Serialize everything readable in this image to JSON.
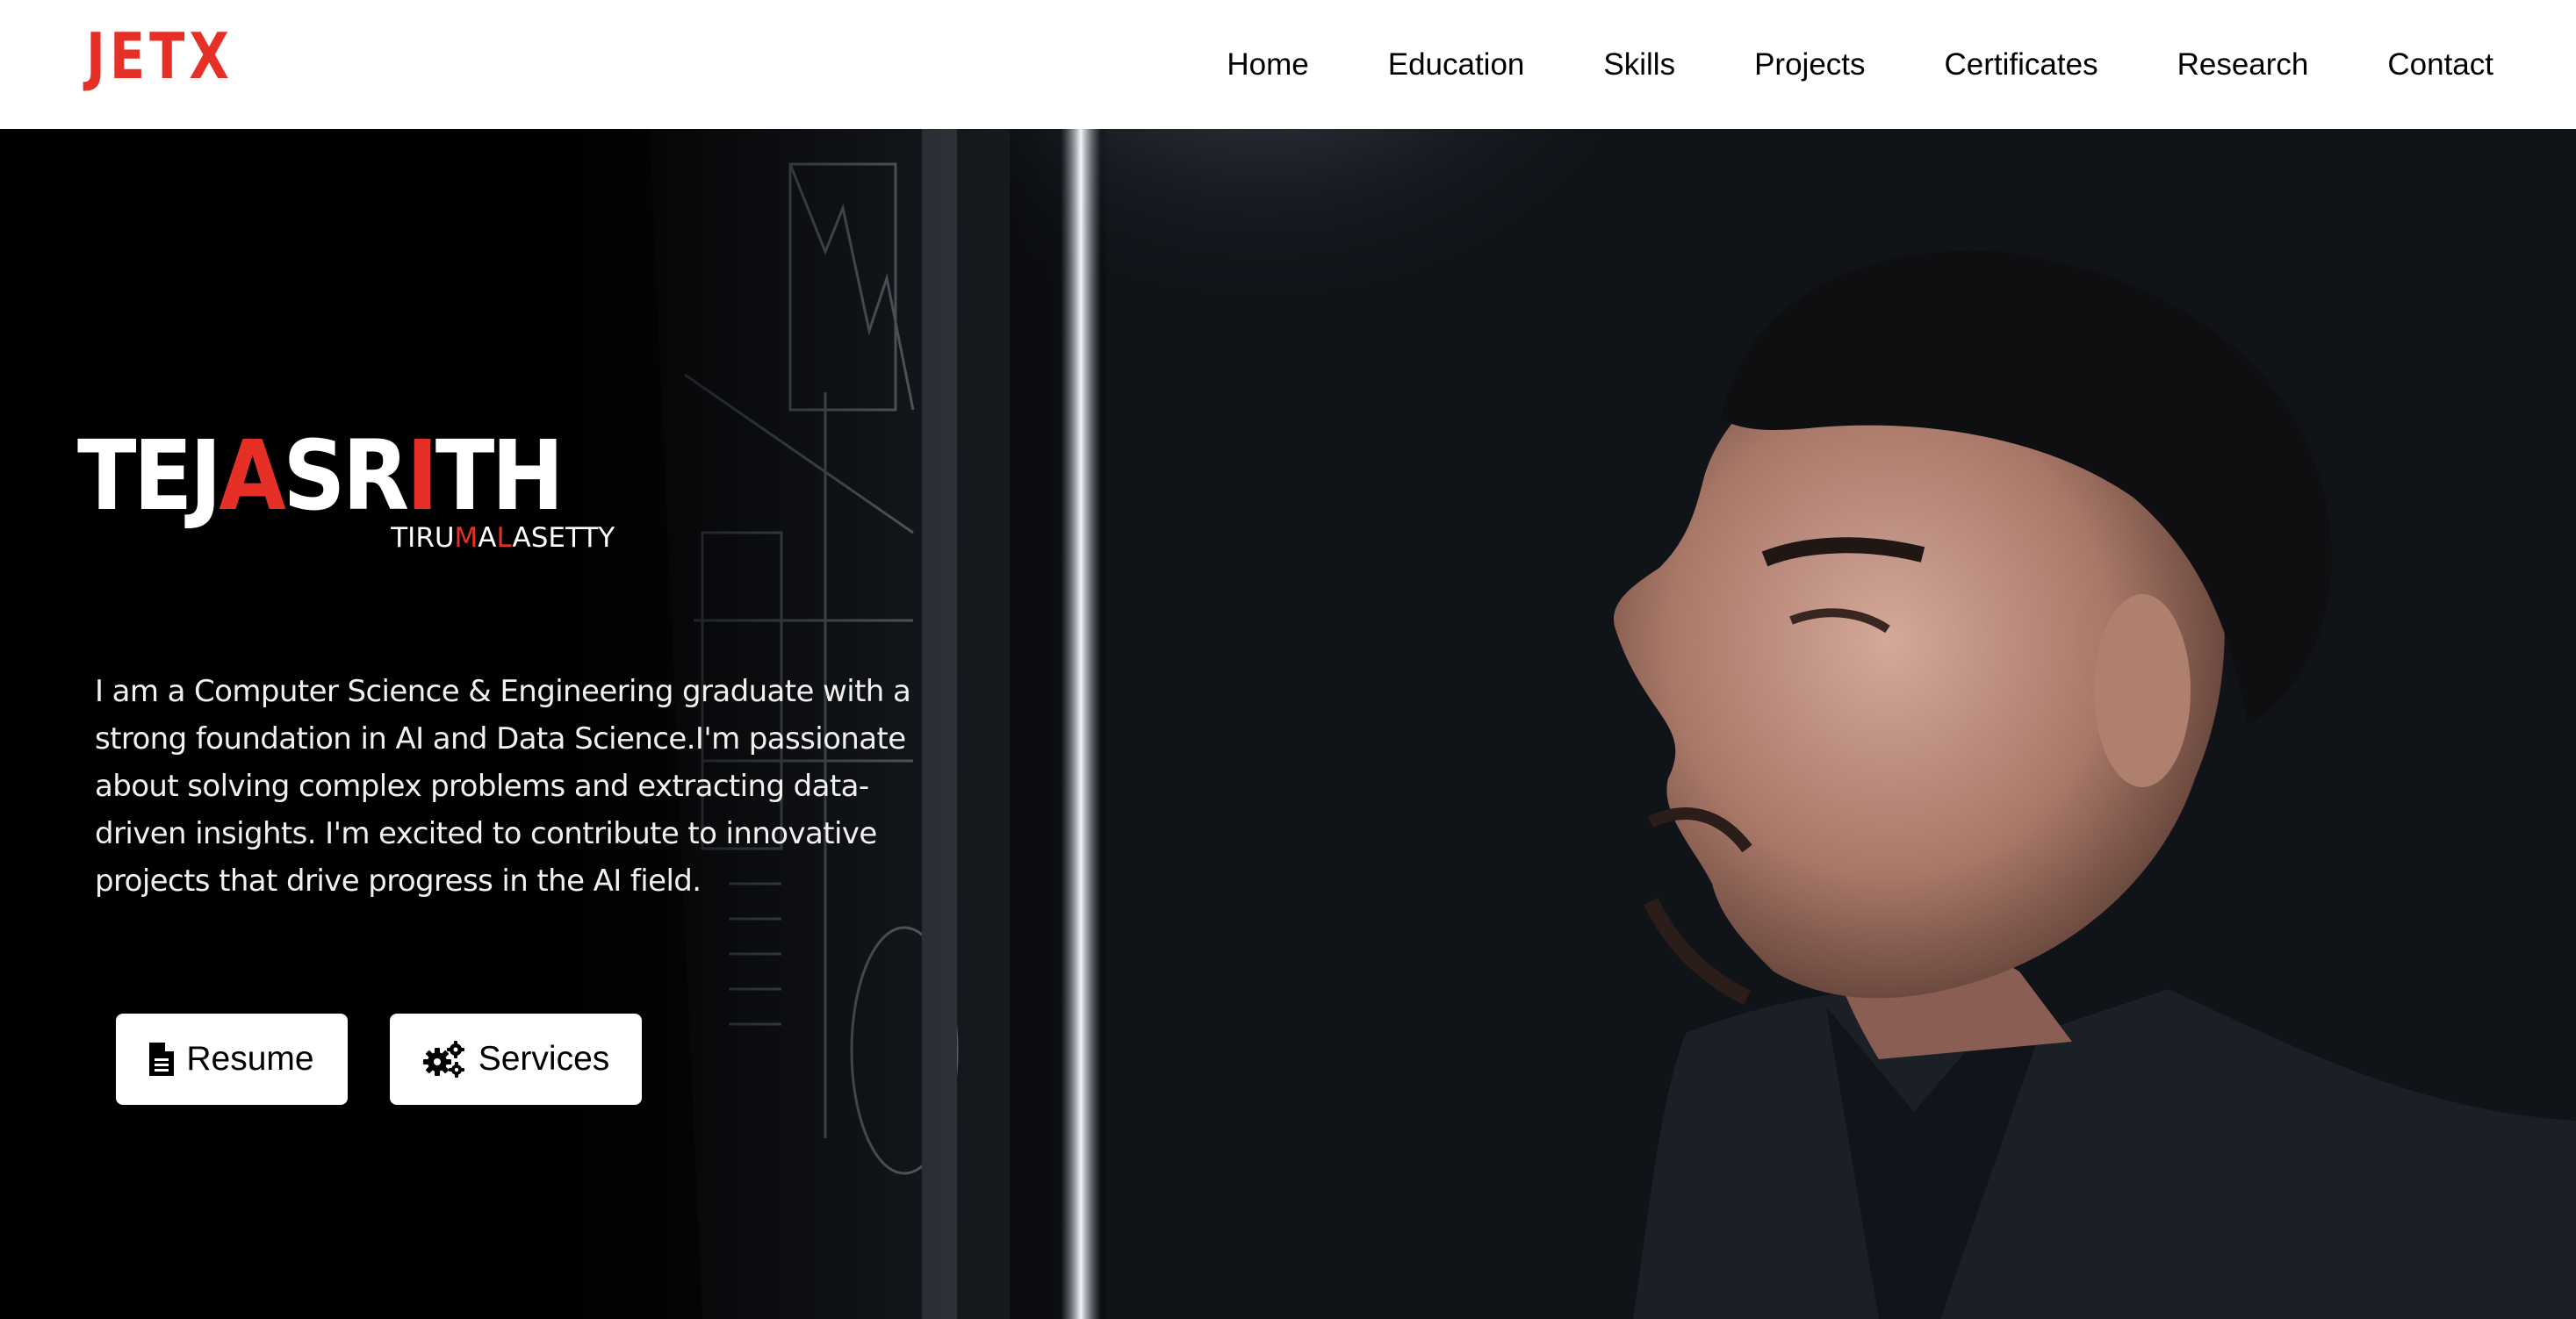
{
  "header": {
    "logo": "JETX",
    "nav": [
      "Home",
      "Education",
      "Skills",
      "Projects",
      "Certificates",
      "Research",
      "Contact"
    ]
  },
  "hero": {
    "name": {
      "first_parts": [
        "TEJ",
        "A",
        "SR",
        "I",
        "TH"
      ],
      "last_parts": [
        "TIRU",
        "M",
        "A",
        "L",
        "ASETTY"
      ]
    },
    "bio": "I am a Computer Science & Engineering graduate with a strong foundation in AI and Data Science.I'm passionate about solving complex problems and extracting data-driven insights. I'm excited to contribute to innovative projects that drive progress in the AI field.",
    "buttons": {
      "resume": {
        "label": "Resume",
        "icon": "file-icon"
      },
      "services": {
        "label": "Services",
        "icon": "gears-icon"
      }
    }
  },
  "colors": {
    "accent": "#e63027",
    "header_bg": "#ffffff",
    "hero_bg": "#070809",
    "button_bg": "#ffffff"
  }
}
